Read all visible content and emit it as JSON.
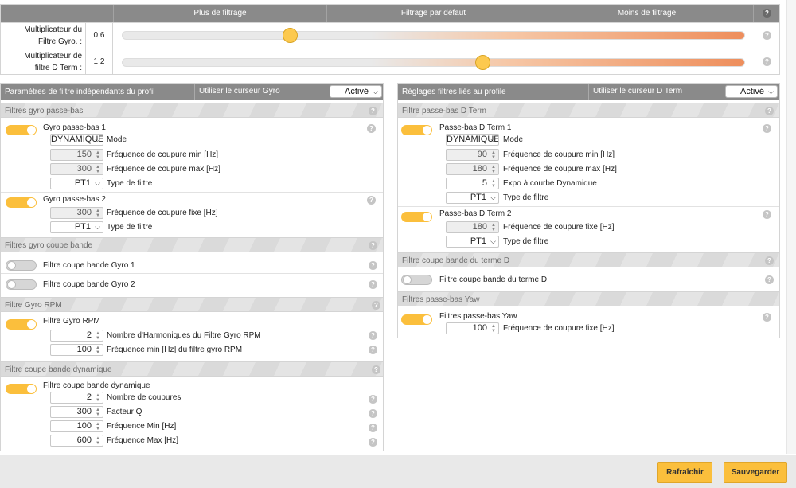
{
  "sliders": {
    "headers": [
      "Plus de filtrage",
      "Filtrage par défaut",
      "Moins de filtrage"
    ],
    "rows": [
      {
        "label_line1": "Multiplicateur du",
        "label_line2": "Filtre Gyro. :",
        "value": "0.6",
        "level": 0.6
      },
      {
        "label_line1": "Multiplicateur de",
        "label_line2": "filtre D Term :",
        "value": "1.2",
        "level": 1.2
      }
    ]
  },
  "left_panel": {
    "title": "Paramètres de filtre indépendants du profil",
    "slider_label": "Utiliser le curseur Gyro",
    "slider_select": "Activé",
    "sections": {
      "lowpass": "Filtres gyro passe-bas",
      "notch": "Filtres gyro coupe bande",
      "rpm": "Filtre Gyro RPM",
      "dyn": "Filtre coupe bande dynamique"
    },
    "lp1": {
      "title": "Gyro passe-bas 1",
      "mode_value": "DYNAMIQUE",
      "mode_label": "Mode",
      "min_value": "150",
      "min_label": "Fréquence de coupure min [Hz]",
      "max_value": "300",
      "max_label": "Fréquence de coupure max [Hz]",
      "type_value": "PT1",
      "type_label": "Type de filtre"
    },
    "lp2": {
      "title": "Gyro passe-bas 2",
      "fixed_value": "300",
      "fixed_label": "Fréquence de coupure fixe [Hz]",
      "type_value": "PT1",
      "type_label": "Type de filtre"
    },
    "notch1": "Filtre coupe bande Gyro 1",
    "notch2": "Filtre coupe bande Gyro 2",
    "rpm": {
      "title": "Filtre Gyro RPM",
      "harm_value": "2",
      "harm_label": "Nombre d'Harmoniques du Filtre Gyro RPM",
      "min_value": "100",
      "min_label": "Fréquence min [Hz] du filtre gyro RPM"
    },
    "dyn": {
      "title": "Filtre coupe bande dynamique",
      "count_value": "2",
      "count_label": "Nombre de coupures",
      "q_value": "300",
      "q_label": "Facteur Q",
      "min_value": "100",
      "min_label": "Fréquence Min [Hz]",
      "max_value": "600",
      "max_label": "Fréquence Max [Hz]"
    }
  },
  "right_panel": {
    "title": "Réglages filtres liés au profile",
    "slider_label": "Utiliser le curseur D Term",
    "slider_select": "Activé",
    "sections": {
      "lowpass": "Filtre passe-bas D Term",
      "notch": "Filtre coupe bande du terme D",
      "yaw": "Filtres passe-bas Yaw"
    },
    "lp1": {
      "title": "Passe-bas D Term 1",
      "mode_value": "DYNAMIQUE",
      "mode_label": "Mode",
      "min_value": "90",
      "min_label": "Fréquence de coupure min [Hz]",
      "max_value": "180",
      "max_label": "Fréquence de coupure max [Hz]",
      "expo_value": "5",
      "expo_label": "Expo à courbe Dynamique",
      "type_value": "PT1",
      "type_label": "Type de filtre"
    },
    "lp2": {
      "title": "Passe-bas D Term 2",
      "fixed_value": "180",
      "fixed_label": "Fréquence de coupure fixe [Hz]",
      "type_value": "PT1",
      "type_label": "Type de filtre"
    },
    "notch": "Filtre coupe bande du terme D",
    "yaw": {
      "title": "Filtres passe-bas Yaw",
      "fixed_value": "100",
      "fixed_label": "Fréquence de coupure fixe [Hz]"
    }
  },
  "buttons": {
    "refresh": "Rafraîchir",
    "save": "Sauvegarder"
  },
  "icons": {
    "help": "help-icon",
    "chevron": "chevron-down-icon",
    "spinner": "spinner-icon"
  },
  "colors": {
    "accent": "#fbbf3c",
    "header": "#8a8a8a",
    "slider_high": "#ee8e5c"
  }
}
